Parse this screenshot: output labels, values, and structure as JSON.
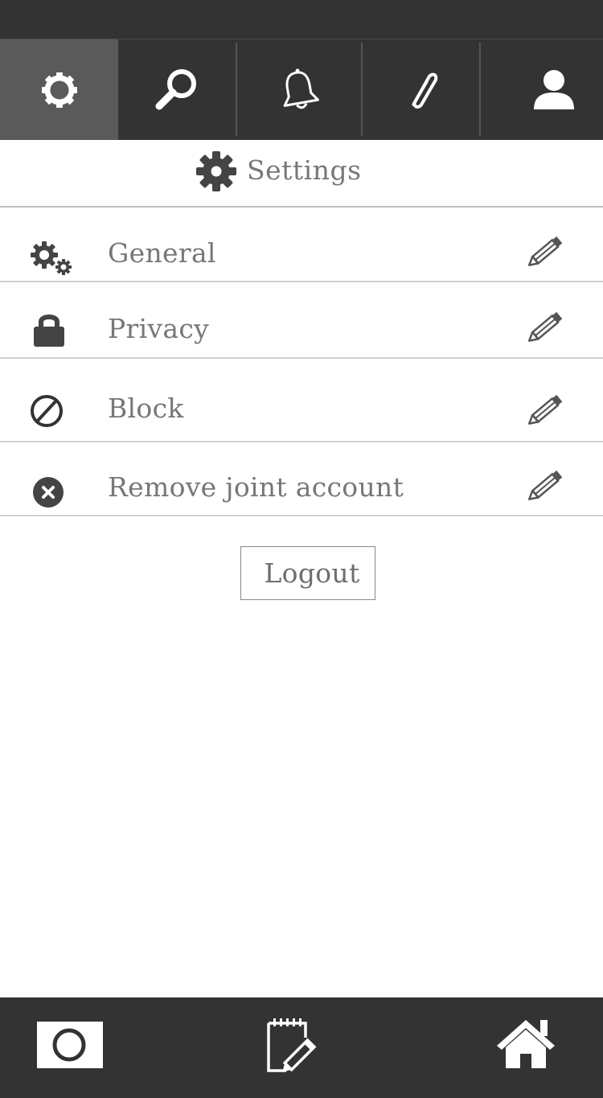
{
  "header": {
    "title": "Settings",
    "icon": "gear-icon"
  },
  "top_nav": {
    "tabs": [
      {
        "icon": "gear-outline-icon",
        "active": true
      },
      {
        "icon": "search-icon",
        "active": false
      },
      {
        "icon": "bell-icon",
        "active": false
      },
      {
        "icon": "paperclip-icon",
        "active": false
      },
      {
        "icon": "user-icon",
        "active": false
      }
    ]
  },
  "settings_items": [
    {
      "label": "General",
      "icon": "gears-icon"
    },
    {
      "label": "Privacy",
      "icon": "lock-icon"
    },
    {
      "label": "Block",
      "icon": "block-icon"
    },
    {
      "label": "Remove joint account",
      "icon": "remove-circle-icon"
    }
  ],
  "logout_label": "Logout",
  "bottom_nav": {
    "items": [
      {
        "icon": "camera-icon"
      },
      {
        "icon": "notepad-edit-icon"
      },
      {
        "icon": "home-icon"
      }
    ]
  },
  "colors": {
    "bar": "#333333",
    "active_tab": "#5a5a5a",
    "text": "#777777",
    "icon": "#444444",
    "divider": "#d0d0d0"
  }
}
